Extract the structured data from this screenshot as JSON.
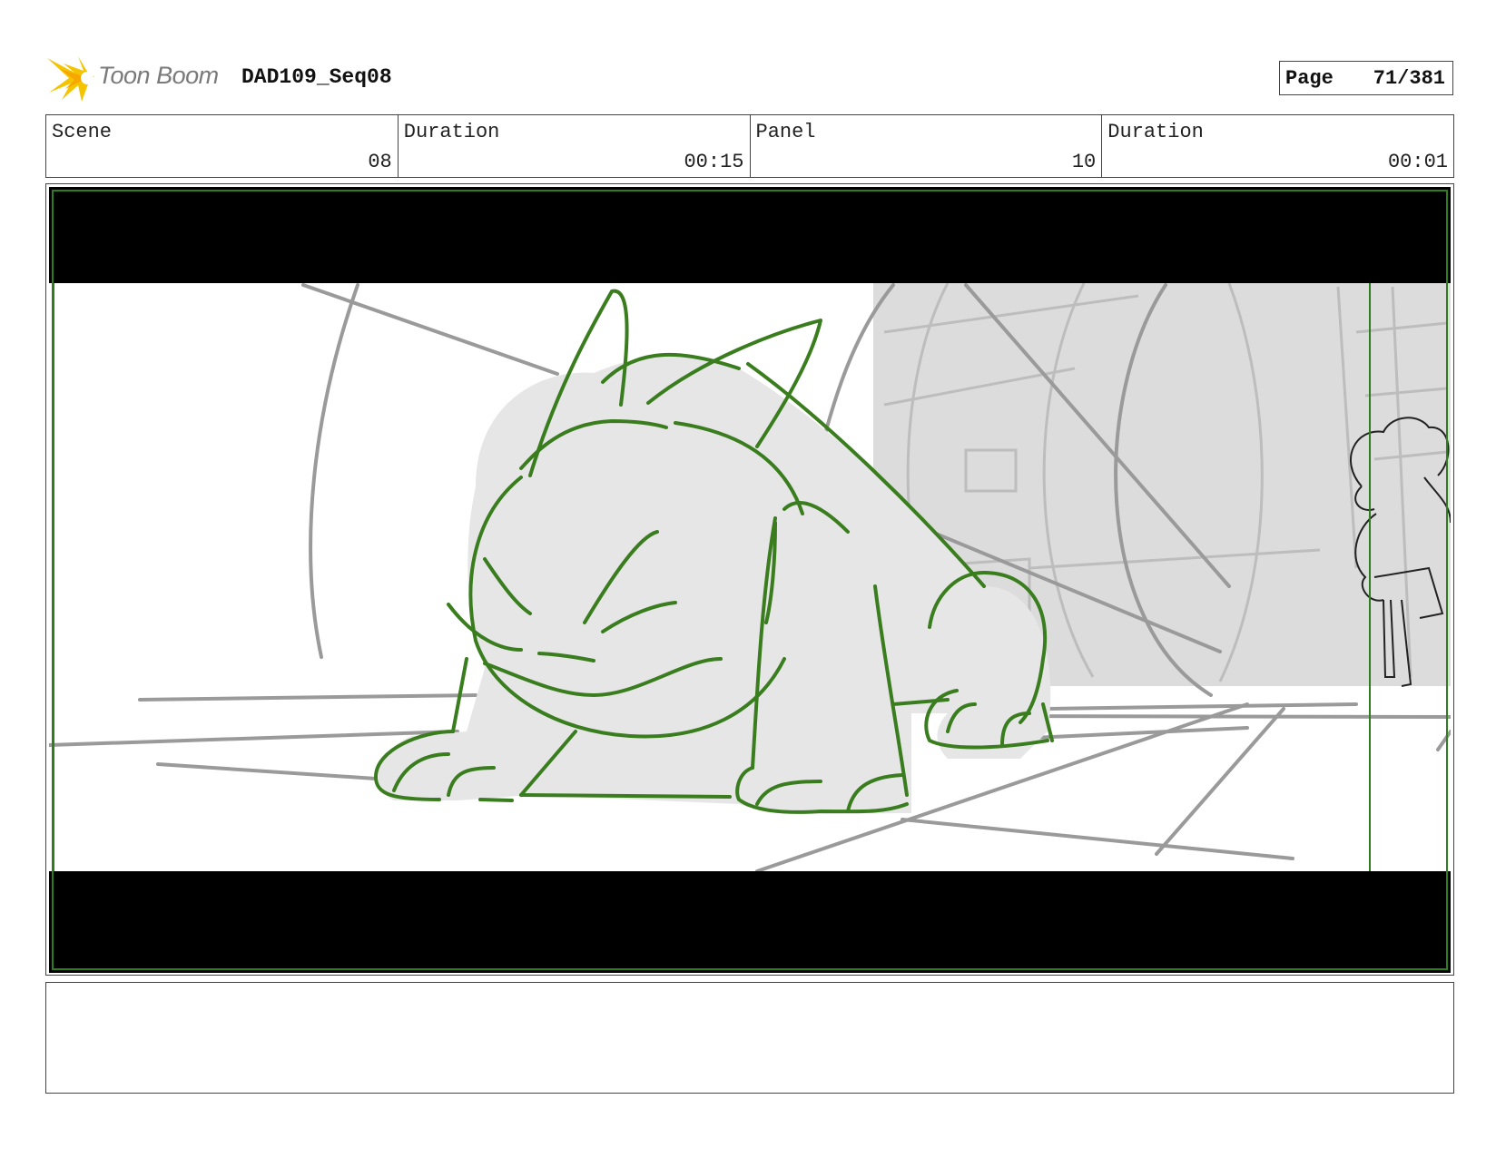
{
  "header": {
    "logo_text": "Toon Boom",
    "project_title": "DAD109_Seq08",
    "page_label": "Page",
    "page_value": "71/381"
  },
  "info": {
    "scene_label": "Scene",
    "scene_value": "08",
    "scene_duration_label": "Duration",
    "scene_duration_value": "00:15",
    "panel_label": "Panel",
    "panel_value": "10",
    "panel_duration_label": "Duration",
    "panel_duration_value": "00:01"
  },
  "notes": {
    "text": ""
  },
  "colors": {
    "sketch_green": "#3a7d1e",
    "safe_frame_green": "#2e7d1e",
    "construction_gray": "#9a9a9a",
    "letterbox": "#000000"
  }
}
